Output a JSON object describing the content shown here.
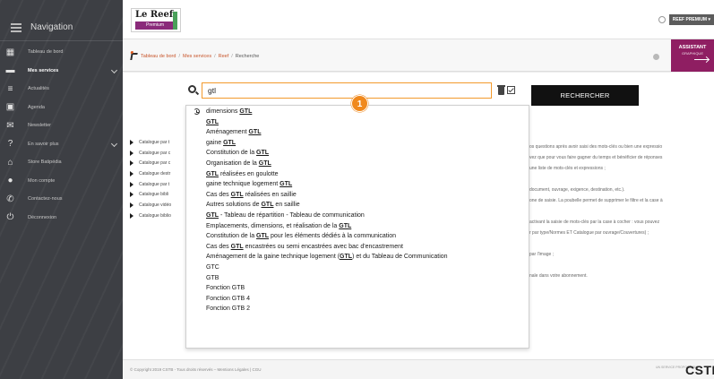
{
  "sidebar": {
    "title": "Navigation",
    "items": [
      {
        "label": "Tableau de bord",
        "icon": "dashboard-icon",
        "glyph": "▦"
      },
      {
        "label": "Mes services",
        "icon": "briefcase-icon",
        "glyph": "▬",
        "active": true,
        "chevron": true
      },
      {
        "label": "Actualités",
        "icon": "news-icon",
        "glyph": "≡"
      },
      {
        "label": "Agenda",
        "icon": "calendar-icon",
        "glyph": "▣"
      },
      {
        "label": "Newsletter",
        "icon": "envelope-icon",
        "glyph": "✉"
      },
      {
        "label": "En savoir plus",
        "icon": "question-icon",
        "glyph": "?",
        "chevron": true
      },
      {
        "label": "Store Batipédia",
        "icon": "store-icon",
        "glyph": "⌂"
      },
      {
        "label": "Mon compte",
        "icon": "user-icon",
        "glyph": "●"
      },
      {
        "label": "Contactez-nous",
        "icon": "phone-icon",
        "glyph": "✆"
      },
      {
        "label": "Déconnexion",
        "icon": "power-icon",
        "glyph": "⏻"
      }
    ]
  },
  "header": {
    "logo_title": "Le Reef",
    "logo_sub": "Premium",
    "user_badge": "REEF PREMIUM ▾"
  },
  "breadcrumb": {
    "items": [
      "Tableau de bord",
      "Mes services",
      "Reef"
    ],
    "current": "Recherche"
  },
  "assistant": {
    "label": "ASSISTANT",
    "sub": "GRAPHIQUE"
  },
  "search": {
    "value": "gtl",
    "button_label": "RECHERCHER"
  },
  "marker_label": "1",
  "catalogue_items": [
    "Catalogue par t",
    "Catalogue par c",
    "Catalogue par c",
    "Catalogue destr",
    "Catalogue par t",
    "Catalogue bibli",
    "Catalogue vidéo",
    "Catalogue biblio"
  ],
  "right_text": [
    "os questions après avoir saisi des mots-clés ou bien une expressio",
    "vez que pour vous faire gagner du temps et bénéficier de réponses",
    "une liste de mots-clés et expressions ;",
    "",
    "document, ouvrage, exigence, destination, etc.).",
    "one de saisie. La poubelle permet de supprimer le filtre et la case à",
    "",
    "activant la saisie de mots-clés par la case à cocher : vous pouvez",
    "r par type/Normes ET Catalogue par ouvrage/Couvertures) ;",
    "",
    "par l'image ;",
    "",
    "nale dans votre abonnement."
  ],
  "suggestions": [
    {
      "before": "dimensions ",
      "match": "GTL",
      "after": "",
      "history": true
    },
    {
      "before": "",
      "match": "GTL",
      "after": ""
    },
    {
      "before": "Aménagement ",
      "match": "GTL",
      "after": ""
    },
    {
      "before": "gaine ",
      "match": "GTL",
      "after": ""
    },
    {
      "before": "Constitution de la ",
      "match": "GTL",
      "after": ""
    },
    {
      "before": "Organisation de la ",
      "match": "GTL",
      "after": ""
    },
    {
      "before": "",
      "match": "GTL",
      "after": " réalisées en goulotte"
    },
    {
      "before": "gaine technique logement ",
      "match": "GTL",
      "after": ""
    },
    {
      "before": "Cas des ",
      "match": "GTL",
      "after": " réalisées en saillie"
    },
    {
      "before": "Autres solutions de ",
      "match": "GTL",
      "after": " en saillie"
    },
    {
      "before": "",
      "match": "GTL",
      "after": " - Tableau de répartition - Tableau de communication"
    },
    {
      "before": "Emplacements, dimensions, et réalisation de la ",
      "match": "GTL",
      "after": ""
    },
    {
      "before": "Constitution de la ",
      "match": "GTL",
      "after": " pour les éléments dédiés à la communication"
    },
    {
      "before": "Cas des ",
      "match": "GTL",
      "after": " encastrées ou semi encastrées avec bac d'encastrement"
    },
    {
      "before": "Aménagement de la gaine technique logement (",
      "match": "GTL",
      "after": ") et du Tableau de Communication"
    },
    {
      "before": "GTC",
      "match": "",
      "after": ""
    },
    {
      "before": "GTB",
      "match": "",
      "after": ""
    },
    {
      "before": "Fonction GTB",
      "match": "",
      "after": ""
    },
    {
      "before": "Fonction GTB 4",
      "match": "",
      "after": ""
    },
    {
      "before": "Fonction GTB 2",
      "match": "",
      "after": ""
    }
  ],
  "footer": {
    "copyright": "© Copyright 2019 CSTB - Tous droits réservés – Mentions Légales | CGU",
    "service": "UN SERVICE PROPOSÉ PAR",
    "brand": "CSTB"
  },
  "colors": {
    "sidebar_bg": "#3d3f44",
    "accent_orange": "#f39a2c",
    "assistant_bg": "#8f1e62",
    "search_button_bg": "#111111"
  }
}
